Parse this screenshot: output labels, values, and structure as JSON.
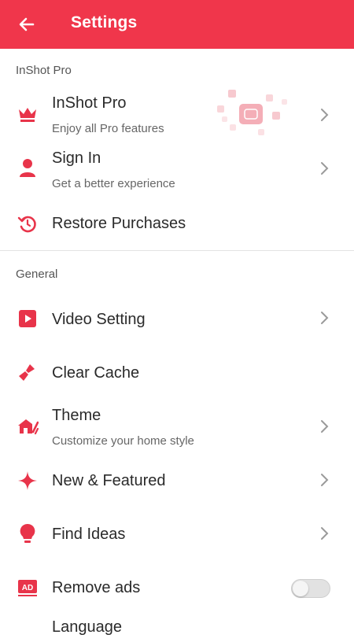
{
  "appbar": {
    "title": "Settings",
    "back_icon": "arrow-left-icon",
    "color": "#f0364b"
  },
  "sections": {
    "pro_header": "InShot Pro",
    "general_header": "General"
  },
  "items": {
    "inshot_pro": {
      "title": "InShot Pro",
      "subtitle": "Enjoy all Pro features",
      "icon": "crown-icon"
    },
    "sign_in": {
      "title": "Sign In",
      "subtitle": "Get a better experience",
      "icon": "person-icon"
    },
    "restore": {
      "title": "Restore Purchases",
      "icon": "restore-icon"
    },
    "video_setting": {
      "title": "Video Setting",
      "icon": "play-icon"
    },
    "clear_cache": {
      "title": "Clear Cache",
      "icon": "broom-icon"
    },
    "theme": {
      "title": "Theme",
      "subtitle": "Customize your home style",
      "icon": "theme-icon"
    },
    "new_featured": {
      "title": "New & Featured",
      "icon": "sparkle-icon"
    },
    "find_ideas": {
      "title": "Find Ideas",
      "icon": "lightbulb-icon"
    },
    "remove_ads": {
      "title": "Remove ads",
      "icon": "ad-badge-icon",
      "toggle_on": false,
      "badge_text": "AD"
    },
    "language": {
      "title": "Language"
    }
  },
  "accent_color": "#e8344a"
}
